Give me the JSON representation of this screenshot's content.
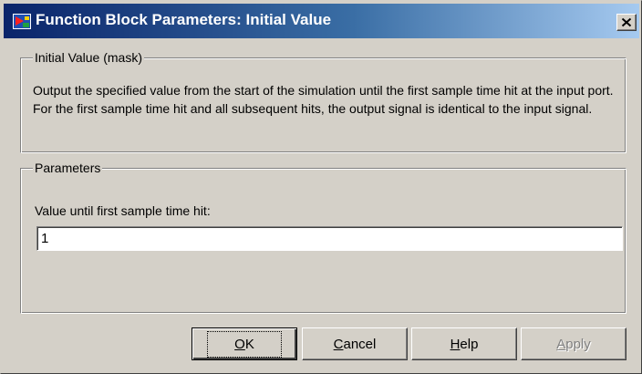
{
  "window": {
    "title": "Function Block Parameters: Initial Value",
    "close_glyph": "✕"
  },
  "description_group": {
    "legend": "Initial Value (mask)",
    "text": "Output the specified value from the start of the simulation until the first sample time hit at the input port. For the first sample time hit and all subsequent hits, the output signal is identical to the input signal."
  },
  "parameters_group": {
    "legend": "Parameters",
    "value_label": "Value until first sample time hit:",
    "value": "1"
  },
  "buttons": {
    "ok": {
      "mnemonic": "O",
      "rest": "K"
    },
    "cancel": {
      "mnemonic": "C",
      "rest": "ancel"
    },
    "help": {
      "mnemonic": "H",
      "rest": "elp"
    },
    "apply": {
      "mnemonic": "A",
      "rest": "pply"
    }
  },
  "icons": {
    "app": "simulink-block-icon",
    "close": "close-icon"
  },
  "colors": {
    "titlebar_start": "#0a246a",
    "titlebar_end": "#a6caf0",
    "face": "#d4d0c8",
    "disabled_text": "#808080"
  }
}
